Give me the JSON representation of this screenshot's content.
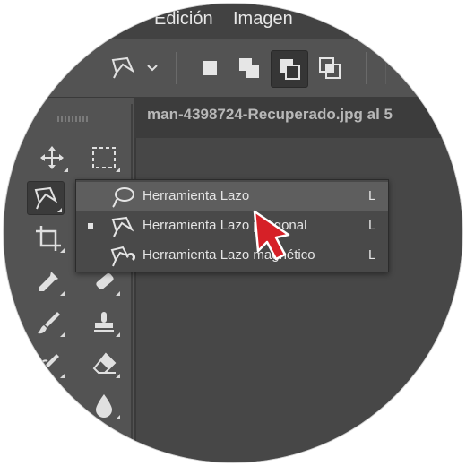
{
  "menubar": {
    "items": [
      "Edición",
      "Imagen"
    ]
  },
  "document": {
    "tab_title": "man-4398724-Recuperado.jpg al 5"
  },
  "toolbar": {
    "tools": [
      "move-tool",
      "rectangular-marquee-tool",
      "lasso-tool",
      "crop-tool",
      "eyedropper-tool",
      "healing-brush-tool",
      "brush-tool",
      "clone-stamp-tool",
      "history-brush-tool",
      "eraser-tool",
      "blur-tool"
    ]
  },
  "flyout": {
    "items": [
      {
        "label": "Herramienta Lazo",
        "shortcut": "L",
        "icon": "lasso-icon",
        "highlighted": true,
        "active": false
      },
      {
        "label": "Herramienta Lazo poligonal",
        "shortcut": "L",
        "icon": "polygonal-lasso-icon",
        "highlighted": false,
        "active": true
      },
      {
        "label": "Herramienta Lazo magnético",
        "shortcut": "L",
        "icon": "magnetic-lasso-icon",
        "highlighted": false,
        "active": false
      }
    ]
  },
  "options_bar": {
    "selection_modes": [
      "new-selection",
      "add-to-selection",
      "subtract-from-selection",
      "intersect-selection"
    ],
    "selected_mode": "subtract-from-selection"
  },
  "colors": {
    "highlight_cursor": "#d62027",
    "panel": "#535353",
    "canvas": "#474747"
  }
}
